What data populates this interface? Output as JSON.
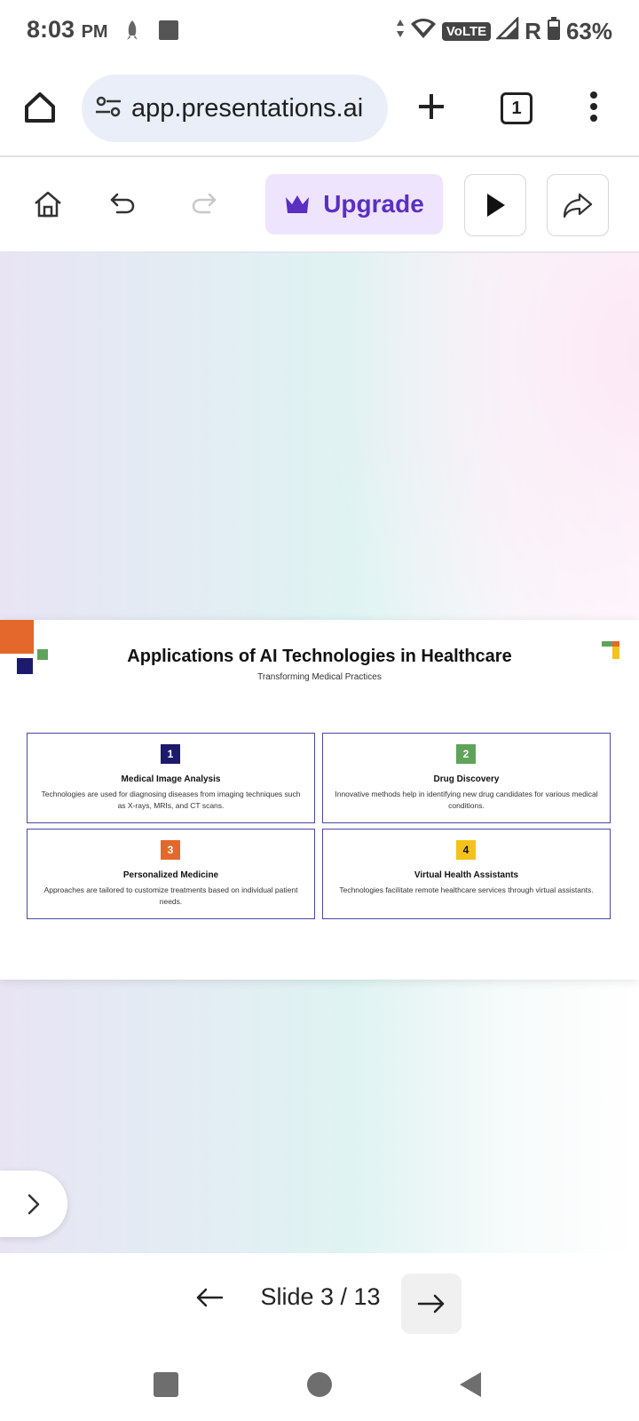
{
  "status_bar": {
    "time": "8:03",
    "ampm": "PM",
    "volte": "VoLTE",
    "roaming": "R",
    "battery": "63%"
  },
  "browser": {
    "url": "app.presentations.ai",
    "tab_count": "1"
  },
  "toolbar": {
    "upgrade_label": "Upgrade"
  },
  "slide": {
    "title": "Applications of AI Technologies in Healthcare",
    "subtitle": "Transforming Medical Practices",
    "cards": [
      {
        "number": "1",
        "title": "Medical Image Analysis",
        "description": "Technologies are used for diagnosing diseases from imaging techniques such as X-rays, MRIs, and CT scans.",
        "color": "#1c1a6b"
      },
      {
        "number": "2",
        "title": "Drug Discovery",
        "description": "Innovative methods help in identifying new drug candidates for various medical conditions.",
        "color": "#5fa35a"
      },
      {
        "number": "3",
        "title": "Personalized Medicine",
        "description": "Approaches are tailored to customize treatments based on individual patient needs.",
        "color": "#e4682c"
      },
      {
        "number": "4",
        "title": "Virtual Health Assistants",
        "description": "Technologies facilitate remote healthcare services through virtual assistants.",
        "color": "#f5c21b"
      }
    ]
  },
  "navigation": {
    "slide_counter": "Slide 3 / 13"
  },
  "colors": {
    "accent": "#5a2fc2",
    "upgrade_bg": "#efe4fd",
    "card_border": "#4a47a3"
  }
}
